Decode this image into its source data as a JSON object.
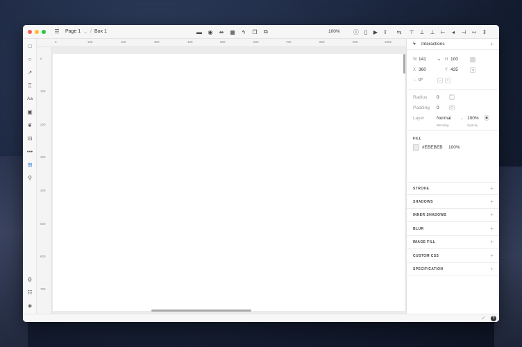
{
  "titlebar": {
    "breadcrumb": [
      "Page 1",
      "Box 1"
    ],
    "zoom": "100%"
  },
  "ruler": {
    "top": [
      "0",
      "100",
      "200",
      "300",
      "400",
      "500",
      "600",
      "700",
      "800",
      "900",
      "1000"
    ],
    "left": [
      "0",
      "100",
      "200",
      "300",
      "400",
      "500",
      "600",
      "700"
    ]
  },
  "panel": {
    "interactions_title": "Interactions",
    "w_label": "W",
    "w_value": "141",
    "h_label": "H",
    "h_value": "100",
    "x_label": "X",
    "x_value": "360",
    "y_label": "Y",
    "y_value": "435",
    "rotation_value": "0°",
    "radius_label": "Radius",
    "radius_value": "0",
    "padding_label": "Padding",
    "padding_value": "0",
    "layer_label": "Layer",
    "blending_value": "Normal",
    "opacity_value": "100%",
    "blending_caption": "Blending",
    "opacity_caption": "Opacity",
    "fill_title": "FILL",
    "fill_hex": "#EBEBEB",
    "fill_opacity": "100%",
    "fill_color": "#ebebeb",
    "sections": [
      "STROKE",
      "SHADOWS",
      "INNER SHADOWS",
      "BLUR",
      "IMAGE FILL",
      "CUSTOM CSS",
      "SPECIFICATION"
    ]
  },
  "left_tools": {
    "text_tool": "Aa",
    "code_tool": "{}"
  }
}
